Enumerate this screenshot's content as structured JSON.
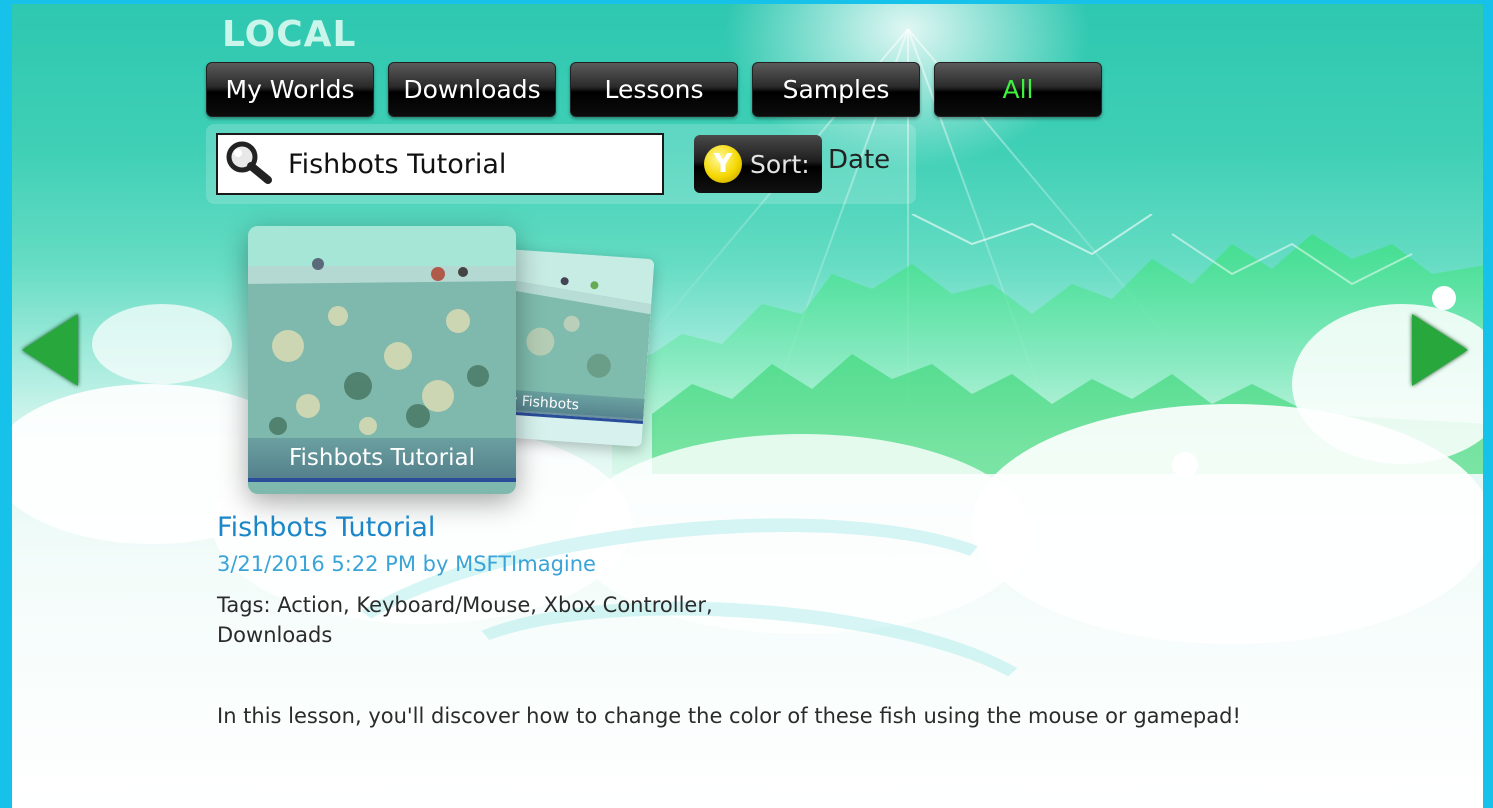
{
  "header": {
    "title": "LOCAL",
    "tabs": [
      {
        "label": "My Worlds",
        "active": false
      },
      {
        "label": "Downloads",
        "active": false
      },
      {
        "label": "Lessons",
        "active": false
      },
      {
        "label": "Samples",
        "active": false
      },
      {
        "label": "All",
        "active": true
      }
    ]
  },
  "search": {
    "value": "Fishbots Tutorial",
    "icon": "search-icon"
  },
  "sort": {
    "button_glyph": "Y",
    "label": "Sort:",
    "value": "Date"
  },
  "navigation": {
    "previous_icon": "arrow-left-icon",
    "next_icon": "arrow-right-icon"
  },
  "cards": {
    "selected": {
      "caption": "Fishbots Tutorial"
    },
    "next": {
      "caption": "by Fishbots"
    }
  },
  "details": {
    "title": "Fishbots Tutorial",
    "meta": "3/21/2016 5:22 PM by MSFTImagine",
    "tags_line1": "Tags: Action, Keyboard/Mouse, Xbox Controller,",
    "tags_line2": "Downloads",
    "description": "In this lesson, you'll discover how to change the color of these fish using the mouse or gamepad!"
  },
  "colors": {
    "tab_active_text": "#3ff03f",
    "title_blue": "#1b87c9",
    "meta_blue": "#3aa3d8",
    "arrow_green": "#28a83c",
    "frame_cyan": "#16c2ea"
  }
}
